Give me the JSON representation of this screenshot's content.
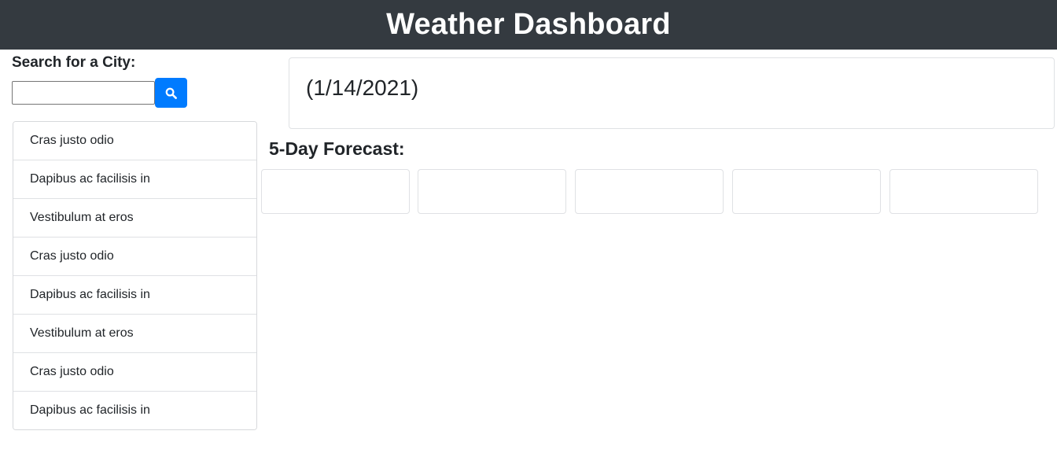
{
  "header": {
    "title": "Weather Dashboard"
  },
  "search": {
    "label": "Search for a City:",
    "value": "",
    "placeholder": "",
    "button_icon": "search-icon"
  },
  "history": {
    "items": [
      {
        "label": "Cras justo odio"
      },
      {
        "label": "Dapibus ac facilisis in"
      },
      {
        "label": "Vestibulum at eros"
      },
      {
        "label": "Cras justo odio"
      },
      {
        "label": "Dapibus ac facilisis in"
      },
      {
        "label": "Vestibulum at eros"
      },
      {
        "label": "Cras justo odio"
      },
      {
        "label": "Dapibus ac facilisis in"
      }
    ]
  },
  "current": {
    "date": "(1/14/2021)"
  },
  "forecast": {
    "title": "5-Day Forecast:",
    "cards": [
      {},
      {},
      {},
      {},
      {}
    ]
  },
  "colors": {
    "header_bg": "#343a40",
    "header_text": "#ffffff",
    "accent": "#007bff",
    "border": "#dfe1e4"
  }
}
